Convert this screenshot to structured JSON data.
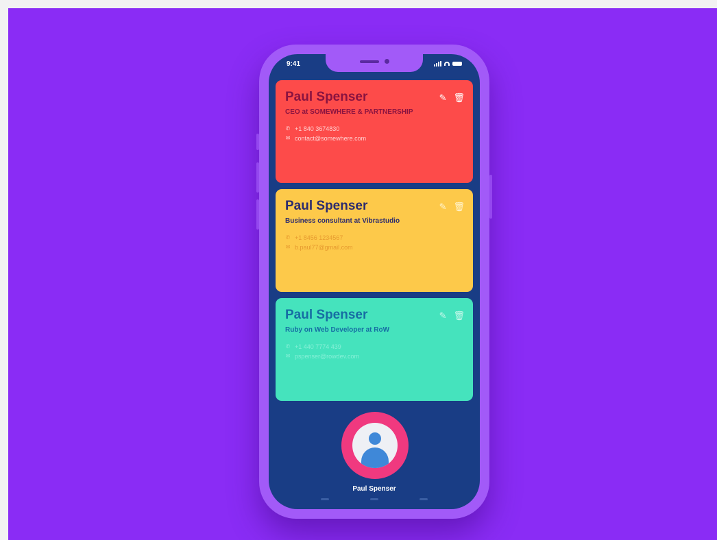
{
  "status": {
    "time": "9:41"
  },
  "cards": [
    {
      "name": "Paul Spenser",
      "role": "CEO at SOMEWHERE & PARTNERSHIP",
      "phone": "+1 840 3674830",
      "email": "contact@somewhere.com",
      "color": "#fd4b4a"
    },
    {
      "name": "Paul Spenser",
      "role": "Business consultant at Vibrastudio",
      "phone": "+1 8456 1234567",
      "email": "b.paul77@gmail.com",
      "color": "#fdc94a"
    },
    {
      "name": "Paul Spenser",
      "role": "Ruby on Web Developer at RoW",
      "phone": "+1 440 7774 439",
      "email": "pspenser@rowdev.com",
      "color": "#45e3bd"
    }
  ],
  "profile": {
    "name": "Paul Spenser",
    "ring_color": "#f0397f"
  },
  "icons": {
    "edit": "pencil-icon",
    "delete": "trash-icon",
    "phone": "phone-icon",
    "email": "email-icon"
  },
  "colors": {
    "background": "#8a2cf5",
    "phone_frame": "#a25af8",
    "screen": "#193d85"
  }
}
